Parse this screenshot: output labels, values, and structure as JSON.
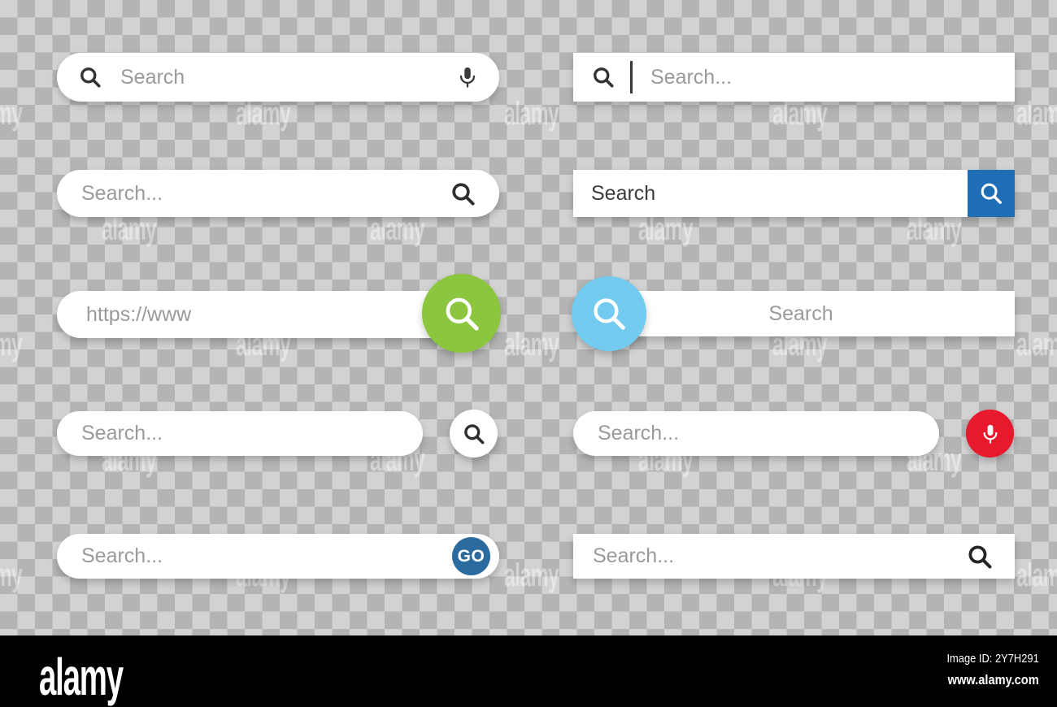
{
  "canvas": {
    "background": "transparent-checkerboard",
    "checker_light": "#d2d2d2",
    "checker_dark": "#b4b4b4",
    "watermark_text": "alamy"
  },
  "colors": {
    "white": "#ffffff",
    "placeholder_grey": "#9a9a9a",
    "icon_dark": "#333333",
    "blue_square": "#1f6eb5",
    "green_circle": "#8cc63e",
    "light_blue_circle": "#74cbf0",
    "red_circle": "#e8192c",
    "go_blue": "#2a6a9e",
    "footer_black": "#000000"
  },
  "search_bars": [
    {
      "id": "pill-mic",
      "shape": "pill",
      "placeholder": "Search",
      "leading_icon": "search-icon",
      "trailing_icon": "microphone-icon"
    },
    {
      "id": "rect-caret",
      "shape": "rectangle",
      "placeholder": "Search...",
      "leading_icon": "search-icon",
      "caret": true
    },
    {
      "id": "pill-trailing-search",
      "shape": "pill",
      "placeholder": "Search...",
      "trailing_icon": "search-icon"
    },
    {
      "id": "rect-blue-button",
      "shape": "rectangle",
      "placeholder": "Search",
      "button": {
        "label_icon": "search-icon",
        "color": "#1f6eb5",
        "shape": "square"
      }
    },
    {
      "id": "pill-url-green",
      "shape": "pill",
      "placeholder": "https://www",
      "button": {
        "label_icon": "search-icon",
        "color": "#8cc63e",
        "shape": "circle",
        "position": "right-overlap"
      }
    },
    {
      "id": "rect-lightblue-circle",
      "shape": "rectangle",
      "placeholder": "Search",
      "placeholder_align": "center",
      "button": {
        "label_icon": "search-icon",
        "color": "#74cbf0",
        "shape": "circle",
        "position": "left-overlap"
      }
    },
    {
      "id": "pill-detached-search",
      "shape": "pill",
      "placeholder": "Search...",
      "button": {
        "label_icon": "search-icon",
        "color": "#ffffff",
        "shape": "circle",
        "position": "right-detached"
      }
    },
    {
      "id": "pill-detached-mic-red",
      "shape": "pill",
      "placeholder": "Search...",
      "button": {
        "label_icon": "microphone-icon",
        "color": "#e8192c",
        "shape": "circle",
        "position": "right-detached"
      }
    },
    {
      "id": "pill-go",
      "shape": "pill",
      "placeholder": "Search...",
      "button": {
        "label": "GO",
        "color": "#2a6a9e",
        "shape": "circle",
        "position": "right-inside"
      }
    },
    {
      "id": "rect-trailing-search",
      "shape": "rectangle",
      "placeholder": "Search...",
      "trailing_icon": "search-icon"
    }
  ],
  "footer": {
    "logo": "alamy",
    "image_id": "Image ID: 2Y7H291",
    "url": "www.alamy.com"
  }
}
